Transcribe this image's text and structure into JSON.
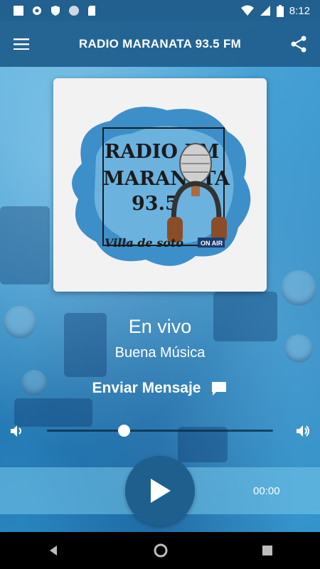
{
  "status_bar": {
    "time": "8:12",
    "icons_left": [
      "square-icon",
      "gear-icon",
      "shield-icon",
      "circle-icon",
      "sd-card-icon"
    ],
    "icons_right": [
      "wifi-icon",
      "signal-icon",
      "battery-icon"
    ]
  },
  "app_bar": {
    "title": "RADIO MARANATA 93.5 FM",
    "menu_icon": "hamburger-icon",
    "share_icon": "share-icon"
  },
  "logo": {
    "line1": "RADIO FM",
    "line2": "MARANATA",
    "line3": "93.5",
    "line4": "Villa de soto",
    "badge": "ON AIR"
  },
  "now_playing": {
    "title": "En vivo",
    "subtitle": "Buena Música"
  },
  "message": {
    "label": "Enviar Mensaje",
    "icon": "chat-bubble-icon"
  },
  "volume": {
    "level": 0.34,
    "min_icon": "volume-low-icon",
    "max_icon": "volume-high-icon"
  },
  "player": {
    "time": "00:00",
    "play_icon": "play-icon"
  },
  "nav_bar": {
    "back_icon": "back-icon",
    "home_icon": "home-icon",
    "recents_icon": "recents-icon"
  },
  "colors": {
    "status_bar": "#21608f",
    "accent": "#1f5f8e",
    "background": "#2b86bd"
  }
}
